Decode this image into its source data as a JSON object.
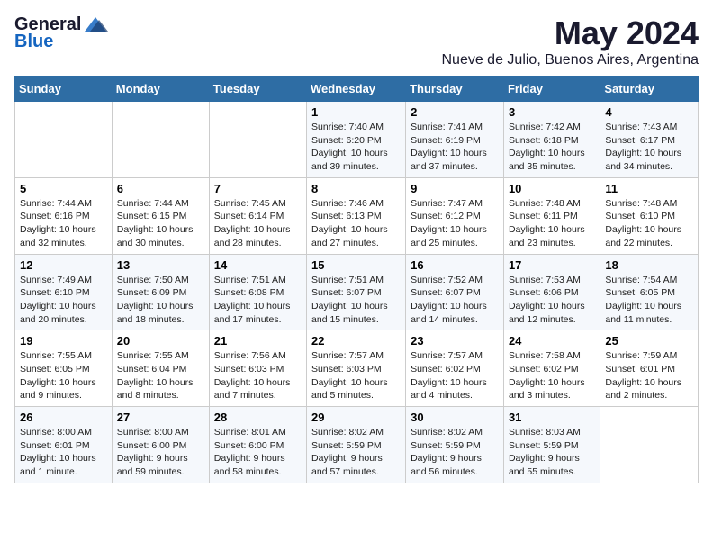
{
  "logo": {
    "general": "General",
    "blue": "Blue"
  },
  "title": {
    "month": "May 2024",
    "location": "Nueve de Julio, Buenos Aires, Argentina"
  },
  "calendar": {
    "headers": [
      "Sunday",
      "Monday",
      "Tuesday",
      "Wednesday",
      "Thursday",
      "Friday",
      "Saturday"
    ],
    "weeks": [
      [
        {
          "day": "",
          "sunrise": "",
          "sunset": "",
          "daylight": ""
        },
        {
          "day": "",
          "sunrise": "",
          "sunset": "",
          "daylight": ""
        },
        {
          "day": "",
          "sunrise": "",
          "sunset": "",
          "daylight": ""
        },
        {
          "day": "1",
          "sunrise": "Sunrise: 7:40 AM",
          "sunset": "Sunset: 6:20 PM",
          "daylight": "Daylight: 10 hours and 39 minutes."
        },
        {
          "day": "2",
          "sunrise": "Sunrise: 7:41 AM",
          "sunset": "Sunset: 6:19 PM",
          "daylight": "Daylight: 10 hours and 37 minutes."
        },
        {
          "day": "3",
          "sunrise": "Sunrise: 7:42 AM",
          "sunset": "Sunset: 6:18 PM",
          "daylight": "Daylight: 10 hours and 35 minutes."
        },
        {
          "day": "4",
          "sunrise": "Sunrise: 7:43 AM",
          "sunset": "Sunset: 6:17 PM",
          "daylight": "Daylight: 10 hours and 34 minutes."
        }
      ],
      [
        {
          "day": "5",
          "sunrise": "Sunrise: 7:44 AM",
          "sunset": "Sunset: 6:16 PM",
          "daylight": "Daylight: 10 hours and 32 minutes."
        },
        {
          "day": "6",
          "sunrise": "Sunrise: 7:44 AM",
          "sunset": "Sunset: 6:15 PM",
          "daylight": "Daylight: 10 hours and 30 minutes."
        },
        {
          "day": "7",
          "sunrise": "Sunrise: 7:45 AM",
          "sunset": "Sunset: 6:14 PM",
          "daylight": "Daylight: 10 hours and 28 minutes."
        },
        {
          "day": "8",
          "sunrise": "Sunrise: 7:46 AM",
          "sunset": "Sunset: 6:13 PM",
          "daylight": "Daylight: 10 hours and 27 minutes."
        },
        {
          "day": "9",
          "sunrise": "Sunrise: 7:47 AM",
          "sunset": "Sunset: 6:12 PM",
          "daylight": "Daylight: 10 hours and 25 minutes."
        },
        {
          "day": "10",
          "sunrise": "Sunrise: 7:48 AM",
          "sunset": "Sunset: 6:11 PM",
          "daylight": "Daylight: 10 hours and 23 minutes."
        },
        {
          "day": "11",
          "sunrise": "Sunrise: 7:48 AM",
          "sunset": "Sunset: 6:10 PM",
          "daylight": "Daylight: 10 hours and 22 minutes."
        }
      ],
      [
        {
          "day": "12",
          "sunrise": "Sunrise: 7:49 AM",
          "sunset": "Sunset: 6:10 PM",
          "daylight": "Daylight: 10 hours and 20 minutes."
        },
        {
          "day": "13",
          "sunrise": "Sunrise: 7:50 AM",
          "sunset": "Sunset: 6:09 PM",
          "daylight": "Daylight: 10 hours and 18 minutes."
        },
        {
          "day": "14",
          "sunrise": "Sunrise: 7:51 AM",
          "sunset": "Sunset: 6:08 PM",
          "daylight": "Daylight: 10 hours and 17 minutes."
        },
        {
          "day": "15",
          "sunrise": "Sunrise: 7:51 AM",
          "sunset": "Sunset: 6:07 PM",
          "daylight": "Daylight: 10 hours and 15 minutes."
        },
        {
          "day": "16",
          "sunrise": "Sunrise: 7:52 AM",
          "sunset": "Sunset: 6:07 PM",
          "daylight": "Daylight: 10 hours and 14 minutes."
        },
        {
          "day": "17",
          "sunrise": "Sunrise: 7:53 AM",
          "sunset": "Sunset: 6:06 PM",
          "daylight": "Daylight: 10 hours and 12 minutes."
        },
        {
          "day": "18",
          "sunrise": "Sunrise: 7:54 AM",
          "sunset": "Sunset: 6:05 PM",
          "daylight": "Daylight: 10 hours and 11 minutes."
        }
      ],
      [
        {
          "day": "19",
          "sunrise": "Sunrise: 7:55 AM",
          "sunset": "Sunset: 6:05 PM",
          "daylight": "Daylight: 10 hours and 9 minutes."
        },
        {
          "day": "20",
          "sunrise": "Sunrise: 7:55 AM",
          "sunset": "Sunset: 6:04 PM",
          "daylight": "Daylight: 10 hours and 8 minutes."
        },
        {
          "day": "21",
          "sunrise": "Sunrise: 7:56 AM",
          "sunset": "Sunset: 6:03 PM",
          "daylight": "Daylight: 10 hours and 7 minutes."
        },
        {
          "day": "22",
          "sunrise": "Sunrise: 7:57 AM",
          "sunset": "Sunset: 6:03 PM",
          "daylight": "Daylight: 10 hours and 5 minutes."
        },
        {
          "day": "23",
          "sunrise": "Sunrise: 7:57 AM",
          "sunset": "Sunset: 6:02 PM",
          "daylight": "Daylight: 10 hours and 4 minutes."
        },
        {
          "day": "24",
          "sunrise": "Sunrise: 7:58 AM",
          "sunset": "Sunset: 6:02 PM",
          "daylight": "Daylight: 10 hours and 3 minutes."
        },
        {
          "day": "25",
          "sunrise": "Sunrise: 7:59 AM",
          "sunset": "Sunset: 6:01 PM",
          "daylight": "Daylight: 10 hours and 2 minutes."
        }
      ],
      [
        {
          "day": "26",
          "sunrise": "Sunrise: 8:00 AM",
          "sunset": "Sunset: 6:01 PM",
          "daylight": "Daylight: 10 hours and 1 minute."
        },
        {
          "day": "27",
          "sunrise": "Sunrise: 8:00 AM",
          "sunset": "Sunset: 6:00 PM",
          "daylight": "Daylight: 9 hours and 59 minutes."
        },
        {
          "day": "28",
          "sunrise": "Sunrise: 8:01 AM",
          "sunset": "Sunset: 6:00 PM",
          "daylight": "Daylight: 9 hours and 58 minutes."
        },
        {
          "day": "29",
          "sunrise": "Sunrise: 8:02 AM",
          "sunset": "Sunset: 5:59 PM",
          "daylight": "Daylight: 9 hours and 57 minutes."
        },
        {
          "day": "30",
          "sunrise": "Sunrise: 8:02 AM",
          "sunset": "Sunset: 5:59 PM",
          "daylight": "Daylight: 9 hours and 56 minutes."
        },
        {
          "day": "31",
          "sunrise": "Sunrise: 8:03 AM",
          "sunset": "Sunset: 5:59 PM",
          "daylight": "Daylight: 9 hours and 55 minutes."
        },
        {
          "day": "",
          "sunrise": "",
          "sunset": "",
          "daylight": ""
        }
      ]
    ]
  }
}
